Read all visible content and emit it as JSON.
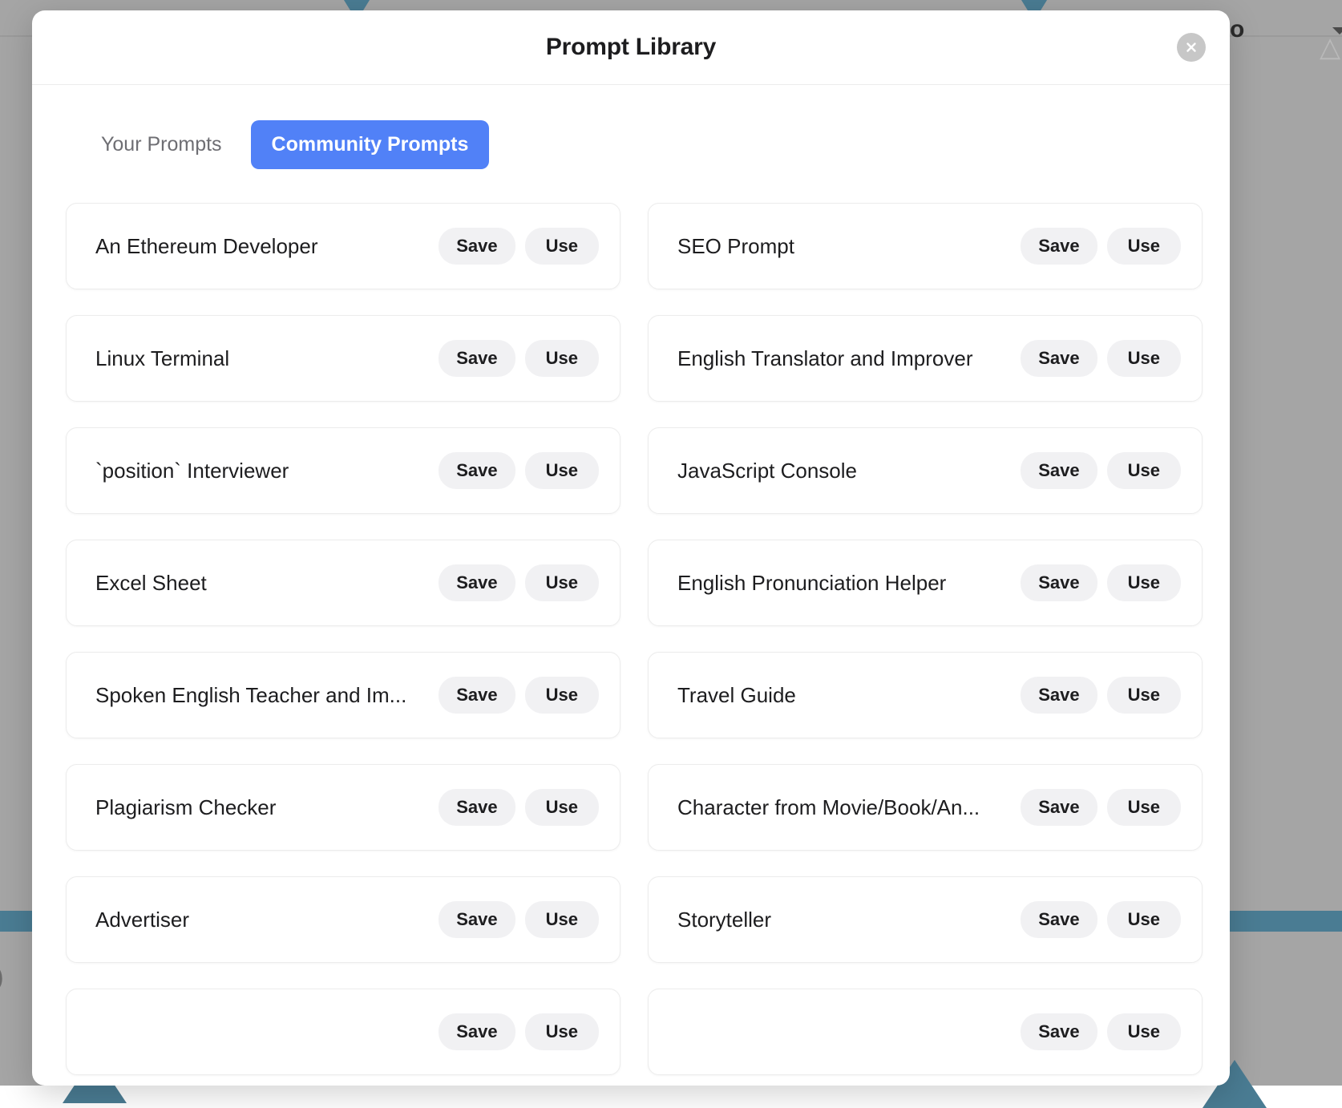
{
  "backdrop": {
    "overlay_color": "#a5a5a5",
    "accent_shape_color": "#4a7c93",
    "right_text": "o",
    "bottom_left_text": ")"
  },
  "modal": {
    "title": "Prompt Library",
    "close_icon": "close-icon",
    "close_label": "Close",
    "accent_color": "#5181f7"
  },
  "tabs": [
    {
      "label": "Your Prompts",
      "active": false
    },
    {
      "label": "Community Prompts",
      "active": true
    }
  ],
  "actions": {
    "save_label": "Save",
    "use_label": "Use"
  },
  "prompts": [
    {
      "title": "An Ethereum Developer"
    },
    {
      "title": "SEO Prompt"
    },
    {
      "title": "Linux Terminal"
    },
    {
      "title": "English Translator and Improver"
    },
    {
      "title": "`position` Interviewer"
    },
    {
      "title": "JavaScript Console"
    },
    {
      "title": "Excel Sheet"
    },
    {
      "title": "English Pronunciation Helper"
    },
    {
      "title": "Spoken English Teacher and Im..."
    },
    {
      "title": "Travel Guide"
    },
    {
      "title": "Plagiarism Checker"
    },
    {
      "title": "Character from Movie/Book/An..."
    },
    {
      "title": "Advertiser"
    },
    {
      "title": "Storyteller"
    },
    {
      "title": ""
    },
    {
      "title": ""
    }
  ]
}
